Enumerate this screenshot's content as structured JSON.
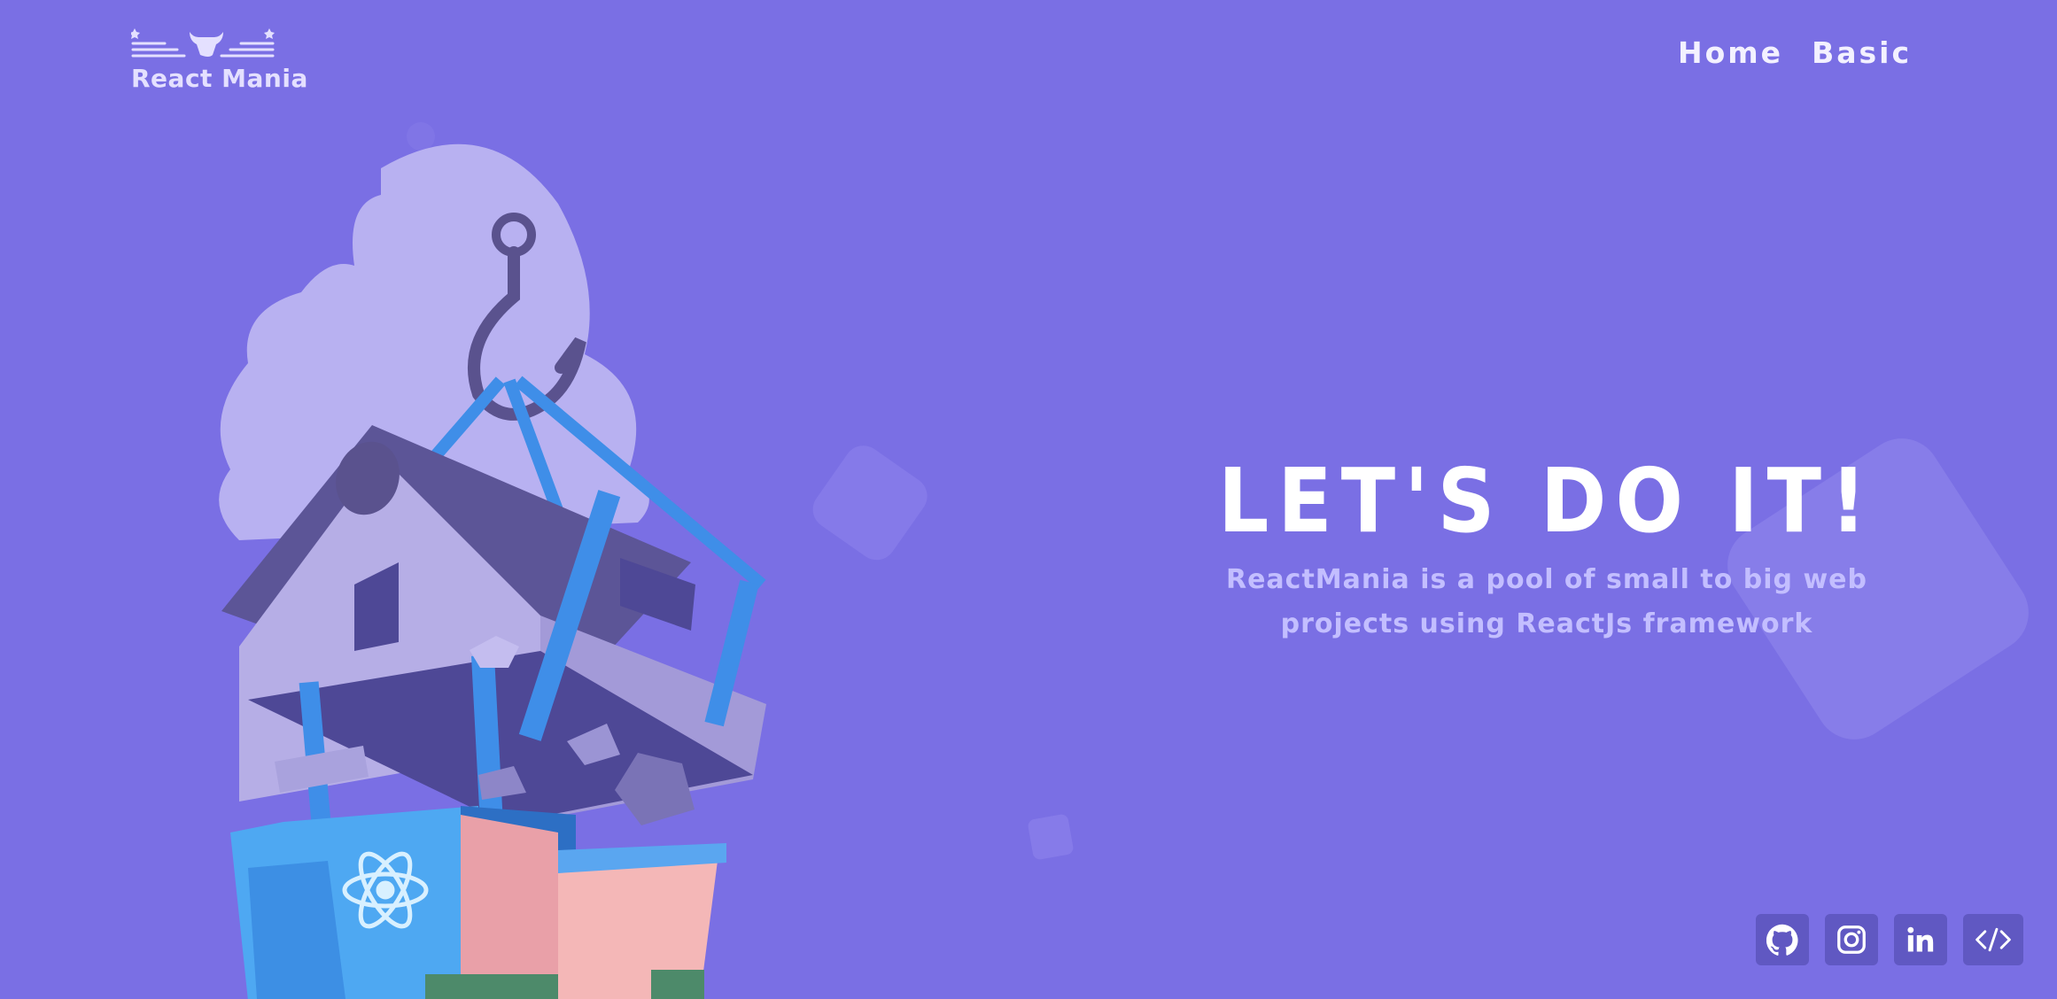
{
  "brand": {
    "name": "React Mania",
    "logo_icon": "bull-head-icon"
  },
  "nav": {
    "items": [
      {
        "label": "Home"
      },
      {
        "label": "Basic"
      }
    ]
  },
  "hero": {
    "title": "LET'S DO IT!",
    "subtitle": "ReactMania is a pool of small to big web projects using ReactJs framework",
    "illustration": "house-lifted-by-hook-over-react-building"
  },
  "socials": [
    {
      "icon": "github-icon"
    },
    {
      "icon": "instagram-icon"
    },
    {
      "icon": "linkedin-icon"
    },
    {
      "icon": "code-icon"
    }
  ],
  "colors": {
    "background": "#7a6fe4",
    "text": "#ffffff",
    "subtitle": "#c3beff",
    "social_bg": "#6058c2"
  }
}
